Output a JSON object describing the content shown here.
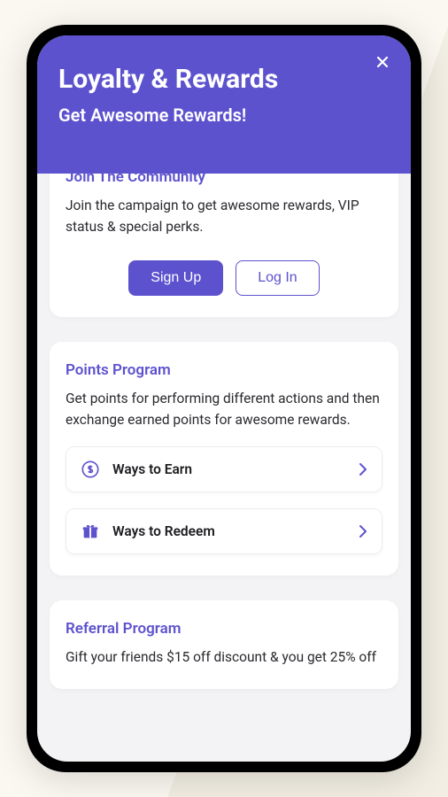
{
  "header": {
    "title": "Loyalty & Rewards",
    "subtitle": "Get Awesome Rewards!"
  },
  "join": {
    "title": "Join The Community",
    "desc": "Join the campaign to get awesome rewards, VIP status & special perks.",
    "signup_label": "Sign Up",
    "login_label": "Log In"
  },
  "points": {
    "title": "Points Program",
    "desc": "Get points for performing different actions and then exchange earned points for awesome rewards.",
    "earn_label": "Ways to Earn",
    "redeem_label": "Ways to Redeem"
  },
  "referral": {
    "title": "Referral Program",
    "desc": "Gift your friends $15 off discount & you get 25% off"
  },
  "colors": {
    "accent": "#5d52ce"
  }
}
